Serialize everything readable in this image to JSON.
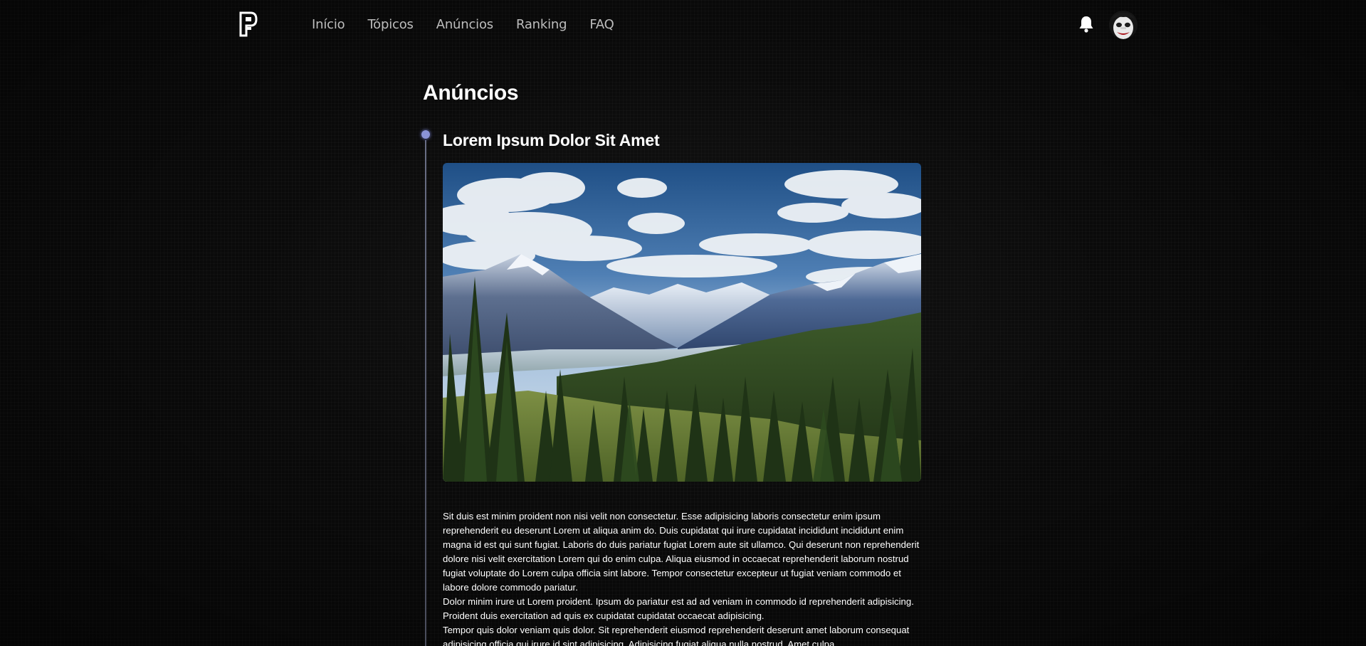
{
  "nav": {
    "logo": "P-logo-icon",
    "links": [
      {
        "label": "Início"
      },
      {
        "label": "Tópicos"
      },
      {
        "label": "Anúncios"
      },
      {
        "label": "Ranking"
      },
      {
        "label": "FAQ"
      }
    ],
    "notification_icon": "bell-icon",
    "avatar_icon": "user-avatar"
  },
  "page": {
    "title": "Anúncios"
  },
  "post": {
    "title": "Lorem Ipsum Dolor Sit Amet",
    "image": "mountain-landscape-image",
    "paragraphs": [
      "Sit duis est minim proident non nisi velit non consectetur. Esse adipisicing laboris consectetur enim ipsum reprehenderit eu deserunt Lorem ut aliqua anim do. Duis cupidatat qui irure cupidatat incididunt incididunt enim magna id est qui sunt fugiat. Laboris do duis pariatur fugiat Lorem aute sit ullamco. Qui deserunt non reprehenderit dolore nisi velit exercitation Lorem qui do enim culpa. Aliqua eiusmod in occaecat reprehenderit laborum nostrud fugiat voluptate do Lorem culpa officia sint labore. Tempor consectetur excepteur ut fugiat veniam commodo et labore dolore commodo pariatur.",
      "Dolor minim irure ut Lorem proident. Ipsum do pariatur est ad ad veniam in commodo id reprehenderit adipisicing. Proident duis exercitation ad quis ex cupidatat cupidatat occaecat adipisicing.",
      "Tempor quis dolor veniam quis dolor. Sit reprehenderit eiusmod reprehenderit deserunt amet laborum consequat adipisicing officia qui irure id sint adipisicing. Adipisicing fugiat aliqua nulla nostrud. Amet culpa"
    ]
  },
  "colors": {
    "background": "#0a0a0a",
    "text": "#ffffff",
    "nav_text": "#bdbdbd",
    "timeline_dot": "#8a93d6",
    "timeline_line": "#5a5e72"
  }
}
